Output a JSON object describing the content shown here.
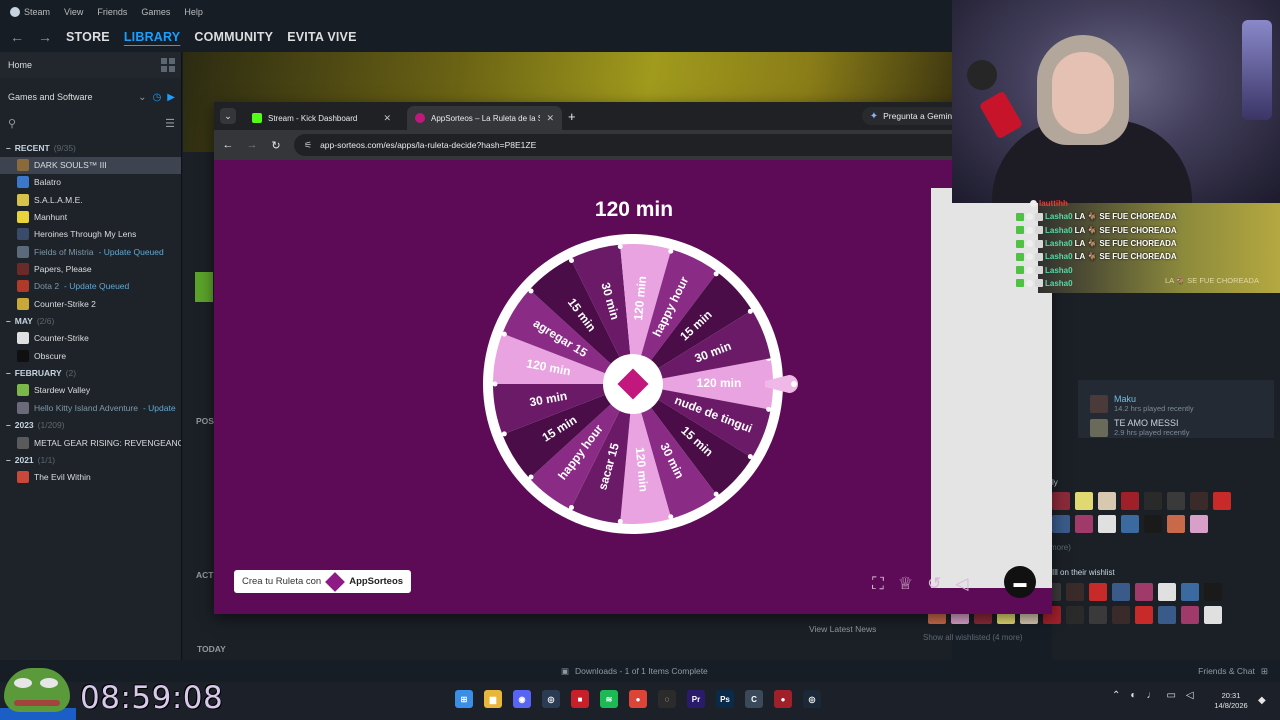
{
  "steam": {
    "menu": [
      "Steam",
      "View",
      "Friends",
      "Games",
      "Help"
    ],
    "nav": {
      "store": "STORE",
      "library": "LIBRARY",
      "community": "COMMUNITY",
      "user": "EVITA VIVE"
    },
    "sidebar": {
      "home": "Home",
      "filter": "Games and Software",
      "sections": [
        {
          "label": "RECENT",
          "count": "(9/35)",
          "games": [
            {
              "name": "DARK SOULS™ III",
              "selected": true,
              "color": "#8a6a3a"
            },
            {
              "name": "Balatro",
              "color": "#3b78c9"
            },
            {
              "name": "S.A.L.A.M.E.",
              "color": "#d9c24a"
            },
            {
              "name": "Manhunt",
              "color": "#e8d43a"
            },
            {
              "name": "Heroines Through My Lens",
              "color": "#3a4a6a"
            },
            {
              "name": "Fields of Mistria",
              "status": " - Update Queued",
              "dim": true,
              "color": "#5a6a7a"
            },
            {
              "name": "Papers, Please",
              "color": "#6a2a2a"
            },
            {
              "name": "Dota 2",
              "status": " - Update Queued",
              "dim": true,
              "color": "#b03a2a"
            },
            {
              "name": "Counter-Strike 2",
              "color": "#c9a83a"
            }
          ]
        },
        {
          "label": "MAY",
          "count": "(2/6)",
          "games": [
            {
              "name": "Counter-Strike",
              "color": "#e0e0e0"
            },
            {
              "name": "Obscure",
              "color": "#101010"
            }
          ]
        },
        {
          "label": "FEBRUARY",
          "count": "(2)",
          "games": [
            {
              "name": "Stardew Valley",
              "color": "#7ab84a"
            },
            {
              "name": "Hello Kitty Island Adventure",
              "status": " - Update",
              "dim": true,
              "color": "#6a6a7a"
            }
          ]
        },
        {
          "label": "2023",
          "count": "(1/209)",
          "games": [
            {
              "name": "METAL GEAR RISING: REVENGEANCE",
              "color": "#5a5a5a"
            }
          ]
        },
        {
          "label": "2021",
          "count": "(1/1)",
          "games": [
            {
              "name": "The Evil Within",
              "color": "#c9483a"
            }
          ]
        }
      ]
    },
    "main": {
      "posts_label": "POS",
      "activity_label": "ACT",
      "today_label": "TODAY",
      "news_button": "View Latest News"
    },
    "bottom": {
      "downloads": "Downloads - 1 of 1 Items Complete",
      "friends_chat": "Friends & Chat"
    },
    "friends_panel": {
      "friends": [
        {
          "name": "Maku",
          "status": "14.2 hrs played recently"
        },
        {
          "name": "TE AMO MESSI",
          "status": "2.9 hrs played recently"
        }
      ],
      "wishlist_label": "Ill on their wishlist",
      "wishlist_more": "Show all wishlisted (4 more)",
      "more_label": "more)",
      "ly_label": "ly"
    }
  },
  "browser": {
    "tabs": [
      {
        "title": "Stream - Kick Dashboard",
        "fav_color": "#53fc18"
      },
      {
        "title": "AppSorteos – La Ruleta de la Suerte",
        "fav_color": "#c2187e",
        "active": true
      }
    ],
    "gemini": "Pregunta a Gemini",
    "url": "app-sorteos.com/es/apps/la-ruleta-decide?hash=P8E1ZE"
  },
  "roulette": {
    "result": "120 min",
    "slices": [
      "120 min",
      "nude de tingui",
      "15 min",
      "30 min",
      "120 min",
      "sacar 15",
      "happy hour",
      "15 min",
      "30 min",
      "120 min",
      "agregar 15",
      "15 min",
      "30 min",
      "120 min",
      "happy hour",
      "15 min",
      "30 min"
    ],
    "slice_colors": [
      "#e8a3e0",
      "#6b1a68",
      "#4a0d47",
      "#8a2b86",
      "#e8a3e0",
      "#6b1a68",
      "#8a2b86",
      "#4a0d47",
      "#6b1a68",
      "#e8a3e0",
      "#8a2b86",
      "#4a0d47",
      "#6b1a68",
      "#e8a3e0",
      "#8a2b86",
      "#4a0d47",
      "#6b1a68"
    ],
    "create_prefix": "Crea tu Ruleta con",
    "brand": "AppSorteos"
  },
  "stream_overlay": {
    "chat": [
      {
        "user": "lauttihh",
        "msg": "",
        "red": true
      },
      {
        "user": "Lasha0",
        "msg": "LA 🐐 SE FUE CHOREADA"
      },
      {
        "user": "Lasha0",
        "msg": "LA 🐐 SE FUE CHOREADA"
      },
      {
        "user": "Lasha0",
        "msg": "LA 🐐 SE FUE CHOREADA"
      },
      {
        "user": "Lasha0",
        "msg": "LA 🐐 SE FUE CHOREADA"
      },
      {
        "user": "Lasha0",
        "msg": ""
      },
      {
        "user": "Lasha0",
        "msg": ""
      }
    ],
    "faint_msg": "LA 🐐 SE FUE CHOREADA",
    "timer": "08:59:08"
  },
  "taskbar": {
    "icons": [
      {
        "name": "windows-start-icon",
        "color": "#3a8ee6",
        "glyph": "⊞"
      },
      {
        "name": "file-explorer-icon",
        "color": "#e8b63a",
        "glyph": "▆"
      },
      {
        "name": "discord-icon",
        "color": "#5865f2",
        "glyph": "◉"
      },
      {
        "name": "steam-icon",
        "color": "#2a3b52",
        "glyph": "◎"
      },
      {
        "name": "app-red-icon",
        "color": "#c8202a",
        "glyph": "■"
      },
      {
        "name": "spotify-icon",
        "color": "#1db954",
        "glyph": "≋"
      },
      {
        "name": "chrome-icon",
        "color": "#db4437",
        "glyph": "●"
      },
      {
        "name": "obs-icon",
        "color": "#2b2b2b",
        "glyph": "◌"
      },
      {
        "name": "premiere-icon",
        "color": "#2a1a6a",
        "glyph": "Pr"
      },
      {
        "name": "photoshop-icon",
        "color": "#0a2a4a",
        "glyph": "Ps"
      },
      {
        "name": "app-c-icon",
        "color": "#3a4a5a",
        "glyph": "C"
      },
      {
        "name": "app-recorder-icon",
        "color": "#a0202a",
        "glyph": "●"
      },
      {
        "name": "steam-tray-icon",
        "color": "#1b2838",
        "glyph": "◎"
      }
    ],
    "clock_time": "20:31",
    "clock_date": "14/8/2026"
  },
  "colors": {
    "roulette_bg": "#5d0b56",
    "accent": "#1a9fff",
    "pointer": "#f0b8e6"
  }
}
